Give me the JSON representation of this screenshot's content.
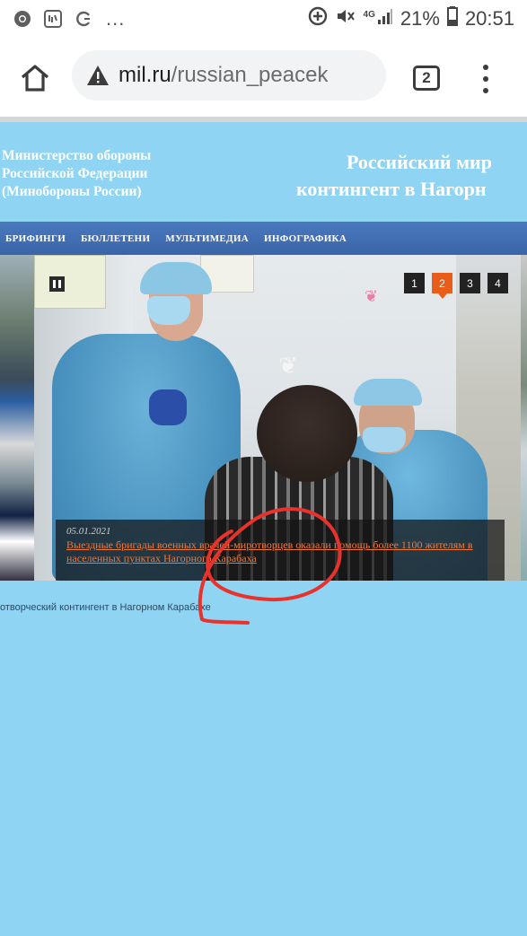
{
  "status_bar": {
    "notification_icons": [
      "chrome-icon",
      "voicemail-icon",
      "sync-icon"
    ],
    "more_indicator": "...",
    "status_icons": [
      "data-saver-icon",
      "mute-icon",
      "signal-icon"
    ],
    "network_label": "4G",
    "battery_percent": "21%",
    "time": "20:51"
  },
  "browser": {
    "url_host": "mil.ru",
    "url_path": "/russian_peacek",
    "tab_count": "2"
  },
  "header": {
    "ministry_line1": "Министерство обороны",
    "ministry_line2": "Российской Федерации",
    "ministry_line3": "(Минобороны России)",
    "title_line1": "Российский мир",
    "title_line2": "контингент в Нагорн"
  },
  "nav": {
    "items": [
      {
        "label": "БРИФИНГИ"
      },
      {
        "label": "БЮЛЛЕТЕНИ"
      },
      {
        "label": "МУЛЬТИМЕДИА"
      },
      {
        "label": "ИНФОГРАФИКА"
      }
    ]
  },
  "slider": {
    "pages": [
      "1",
      "2",
      "3",
      "4"
    ],
    "active_page": "2",
    "caption_date": "05.01.2021",
    "caption_title": "Выездные бригады военных врачей-миротворцев оказали помощь более 1100 жителям в населенных пунктах Нагорного Карабаха"
  },
  "breadcrumb": "отворческий контингент в Нагорном Карабахе",
  "colors": {
    "page_bg": "#8fd4f2",
    "nav_bg": "#3a64a8",
    "active_page": "#e85d1a",
    "caption_link": "#f07838",
    "annotation": "#e8322b"
  }
}
